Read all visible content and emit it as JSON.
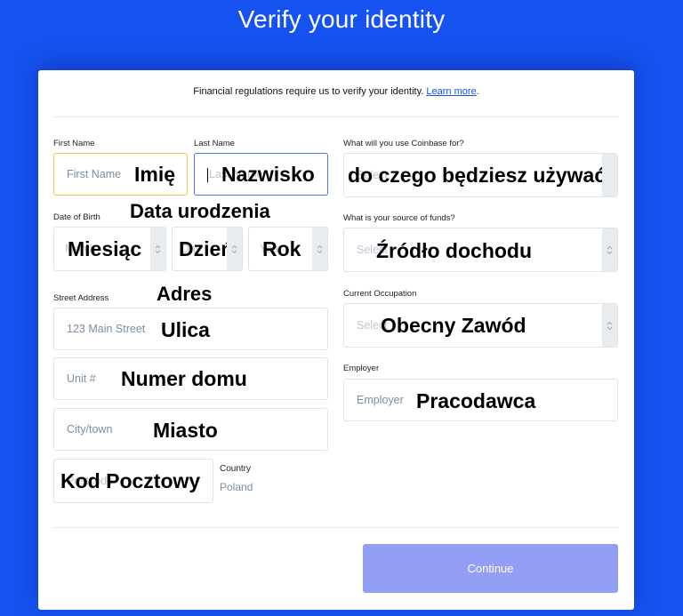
{
  "header": {
    "title": "Verify your identity"
  },
  "notice": {
    "text": "Financial regulations require us to verify your identity. ",
    "link": "Learn more",
    "suffix": "."
  },
  "form": {
    "first_name": {
      "label": "First Name",
      "placeholder": "First Name",
      "overlay": "Imię"
    },
    "last_name": {
      "label": "Last Name",
      "placeholder": "Last Name",
      "overlay": "Nazwisko"
    },
    "dob": {
      "label": "Date of Birth",
      "overlay": "Data urodzenia",
      "month": {
        "placeholder": "Month",
        "overlay": "Miesiąc"
      },
      "day": {
        "placeholder": "Day",
        "overlay": "Dzień"
      },
      "year": {
        "placeholder": "Year",
        "overlay": "Rok"
      }
    },
    "street": {
      "label": "Street Address",
      "label_overlay": "Adres",
      "placeholder": "123 Main Street",
      "overlay": "Ulica"
    },
    "unit": {
      "placeholder": "Unit #",
      "overlay": "Numer domu"
    },
    "city": {
      "placeholder": "City/town",
      "overlay": "Miasto"
    },
    "postcode": {
      "placeholder": "Postcode",
      "overlay": "Kod Pocztowy"
    },
    "country": {
      "label": "Country",
      "value": "Poland"
    },
    "use": {
      "label": "What will you use Coinbase for?",
      "placeholder": "Select",
      "overlay": "do czego będziesz używać"
    },
    "funds": {
      "label": "What is your source of funds?",
      "placeholder": "Select",
      "overlay": "Źródło dochodu"
    },
    "occupation": {
      "label": "Current Occupation",
      "placeholder": "Select",
      "overlay": "Obecny Zawód"
    },
    "employer": {
      "label": "Employer",
      "placeholder": "Employer",
      "overlay": "Pracodawca"
    }
  },
  "actions": {
    "continue_label": "Continue"
  }
}
